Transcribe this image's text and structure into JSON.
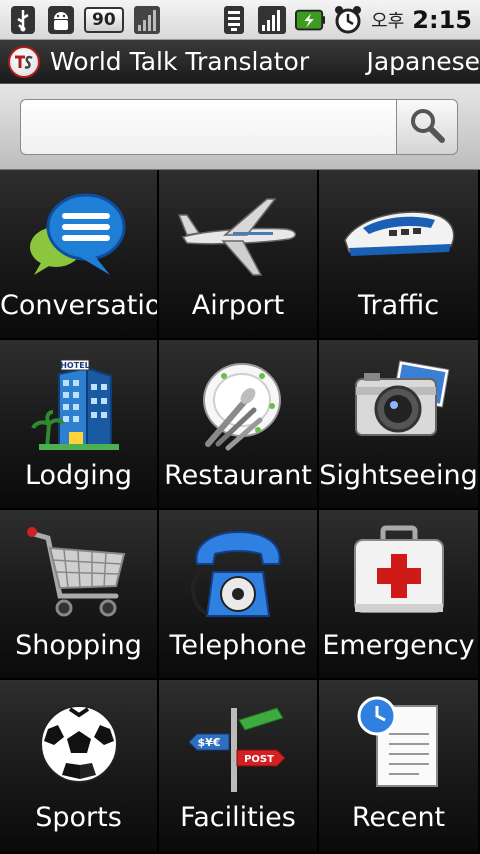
{
  "status_bar": {
    "left_icons": [
      "usb-icon",
      "android-debug-icon"
    ],
    "badge_value": "90",
    "right_icons": [
      "wifi-icon",
      "signal-icon",
      "battery-charging-icon",
      "alarm-icon"
    ],
    "ampm": "오후",
    "time": "2:15"
  },
  "header": {
    "title": "World Talk Translator",
    "language": "Japanese"
  },
  "search": {
    "value": "",
    "placeholder": ""
  },
  "categories": [
    {
      "label": "Conversation",
      "icon": "chat-bubbles-icon"
    },
    {
      "label": "Airport",
      "icon": "airplane-icon"
    },
    {
      "label": "Traffic",
      "icon": "bullet-train-icon"
    },
    {
      "label": "Lodging",
      "icon": "hotel-icon"
    },
    {
      "label": "Restaurant",
      "icon": "plate-cutlery-icon"
    },
    {
      "label": "Sightseeing",
      "icon": "camera-icon"
    },
    {
      "label": "Shopping",
      "icon": "shopping-cart-icon"
    },
    {
      "label": "Telephone",
      "icon": "telephone-icon"
    },
    {
      "label": "Emergency",
      "icon": "first-aid-kit-icon"
    },
    {
      "label": "Sports",
      "icon": "soccer-ball-icon"
    },
    {
      "label": "Facilities",
      "icon": "signpost-icon"
    },
    {
      "label": "Recent",
      "icon": "recent-clock-icon"
    }
  ],
  "colors": {
    "accent_red": "#b01c1c",
    "tile_dark": "#1c1c1c"
  }
}
